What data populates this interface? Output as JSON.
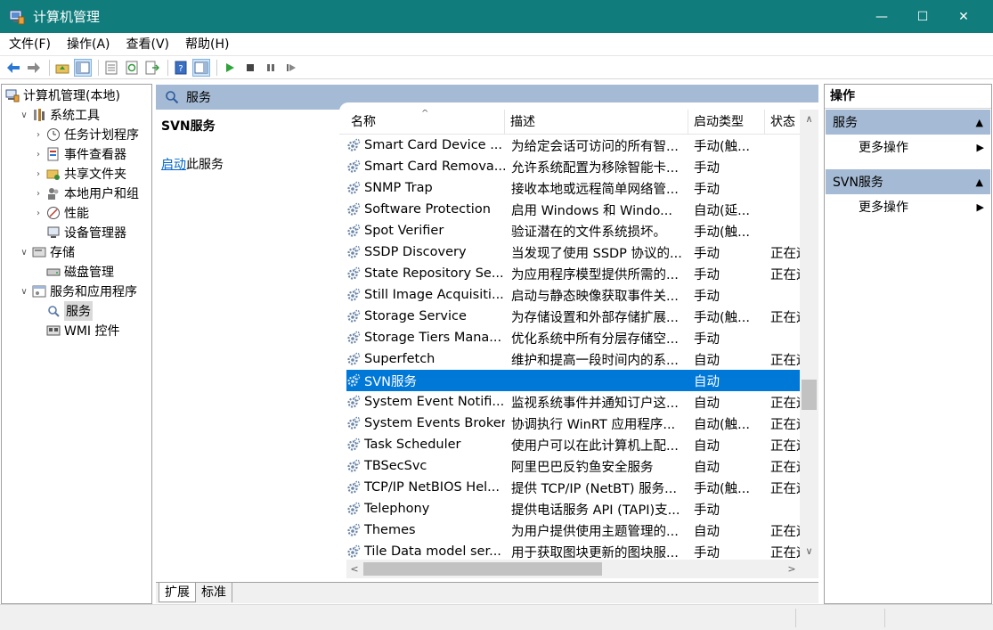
{
  "window": {
    "title": "计算机管理",
    "minimize": "—",
    "maximize": "☐",
    "close": "✕"
  },
  "menu": [
    "文件(F)",
    "操作(A)",
    "查看(V)",
    "帮助(H)"
  ],
  "tree": [
    {
      "label": "计算机管理(本地)",
      "level": 0,
      "chev": "",
      "icon": "computer-management-icon"
    },
    {
      "label": "系统工具",
      "level": 1,
      "chev": "∨",
      "icon": "system-tools-icon"
    },
    {
      "label": "任务计划程序",
      "level": 2,
      "chev": "›",
      "icon": "clock-icon"
    },
    {
      "label": "事件查看器",
      "level": 2,
      "chev": "›",
      "icon": "event-viewer-icon"
    },
    {
      "label": "共享文件夹",
      "level": 2,
      "chev": "›",
      "icon": "shared-folder-icon"
    },
    {
      "label": "本地用户和组",
      "level": 2,
      "chev": "›",
      "icon": "users-icon"
    },
    {
      "label": "性能",
      "level": 2,
      "chev": "›",
      "icon": "performance-icon"
    },
    {
      "label": "设备管理器",
      "level": 2,
      "chev": "",
      "icon": "device-manager-icon"
    },
    {
      "label": "存储",
      "level": 1,
      "chev": "∨",
      "icon": "storage-icon"
    },
    {
      "label": "磁盘管理",
      "level": 2,
      "chev": "",
      "icon": "disk-icon"
    },
    {
      "label": "服务和应用程序",
      "level": 1,
      "chev": "∨",
      "icon": "services-apps-icon"
    },
    {
      "label": "服务",
      "level": 2,
      "chev": "",
      "icon": "services-icon",
      "selected": true
    },
    {
      "label": "WMI 控件",
      "level": 2,
      "chev": "",
      "icon": "wmi-icon"
    }
  ],
  "center": {
    "header": "服务",
    "selected_service_title": "SVN服务",
    "start_link": "启动",
    "start_suffix": "此服务"
  },
  "columns": {
    "name": "名称",
    "desc": "描述",
    "start": "启动类型",
    "status": "状态",
    "sort_arrow": "^"
  },
  "services": [
    {
      "name": "Smart Card Device ...",
      "desc": "为给定会话可访问的所有智...",
      "start": "手动(触...",
      "status": ""
    },
    {
      "name": "Smart Card Remova...",
      "desc": "允许系统配置为移除智能卡...",
      "start": "手动",
      "status": ""
    },
    {
      "name": "SNMP Trap",
      "desc": "接收本地或远程简单网络管...",
      "start": "手动",
      "status": ""
    },
    {
      "name": "Software Protection",
      "desc": "启用 Windows 和 Windo...",
      "start": "自动(延...",
      "status": ""
    },
    {
      "name": "Spot Verifier",
      "desc": "验证潜在的文件系统损坏。",
      "start": "手动(触...",
      "status": ""
    },
    {
      "name": "SSDP Discovery",
      "desc": "当发现了使用 SSDP 协议的...",
      "start": "手动",
      "status": "正在运行"
    },
    {
      "name": "State Repository Se...",
      "desc": "为应用程序模型提供所需的...",
      "start": "手动",
      "status": "正在运行"
    },
    {
      "name": "Still Image Acquisiti...",
      "desc": "启动与静态映像获取事件关...",
      "start": "手动",
      "status": ""
    },
    {
      "name": "Storage Service",
      "desc": "为存储设置和外部存储扩展...",
      "start": "手动(触...",
      "status": "正在运行"
    },
    {
      "name": "Storage Tiers Mana...",
      "desc": "优化系统中所有分层存储空...",
      "start": "手动",
      "status": ""
    },
    {
      "name": "Superfetch",
      "desc": "维护和提高一段时间内的系...",
      "start": "自动",
      "status": "正在运行"
    },
    {
      "name": "SVN服务",
      "desc": "",
      "start": "自动",
      "status": "",
      "selected": true
    },
    {
      "name": "System Event Notifi...",
      "desc": "监视系统事件并通知订户这...",
      "start": "自动",
      "status": "正在运行"
    },
    {
      "name": "System Events Broker",
      "desc": "协调执行 WinRT 应用程序...",
      "start": "自动(触...",
      "status": "正在运行"
    },
    {
      "name": "Task Scheduler",
      "desc": "使用户可以在此计算机上配...",
      "start": "自动",
      "status": "正在运行"
    },
    {
      "name": "TBSecSvc",
      "desc": "阿里巴巴反钓鱼安全服务",
      "start": "自动",
      "status": "正在运行"
    },
    {
      "name": "TCP/IP NetBIOS Hel...",
      "desc": "提供 TCP/IP (NetBT) 服务...",
      "start": "手动(触...",
      "status": "正在运行"
    },
    {
      "name": "Telephony",
      "desc": "提供电话服务 API (TAPI)支...",
      "start": "手动",
      "status": ""
    },
    {
      "name": "Themes",
      "desc": "为用户提供使用主题管理的...",
      "start": "自动",
      "status": "正在运行"
    },
    {
      "name": "Tile Data model ser...",
      "desc": "用于获取图块更新的图块服...",
      "start": "手动",
      "status": "正在运行"
    }
  ],
  "tabs": [
    "扩展",
    "标准"
  ],
  "actions": {
    "title": "操作",
    "sections": [
      {
        "label": "服务",
        "item": "更多操作"
      },
      {
        "label": "SVN服务",
        "item": "更多操作"
      }
    ],
    "collapse_glyph": "▲",
    "expand_glyph": "▶"
  },
  "scroll": {
    "up": "∧",
    "down": "∨",
    "left": "<",
    "right": ">"
  },
  "colors": {
    "titlebar": "#107c7c",
    "selection": "#0078d7",
    "section_header": "#a5bad4"
  }
}
